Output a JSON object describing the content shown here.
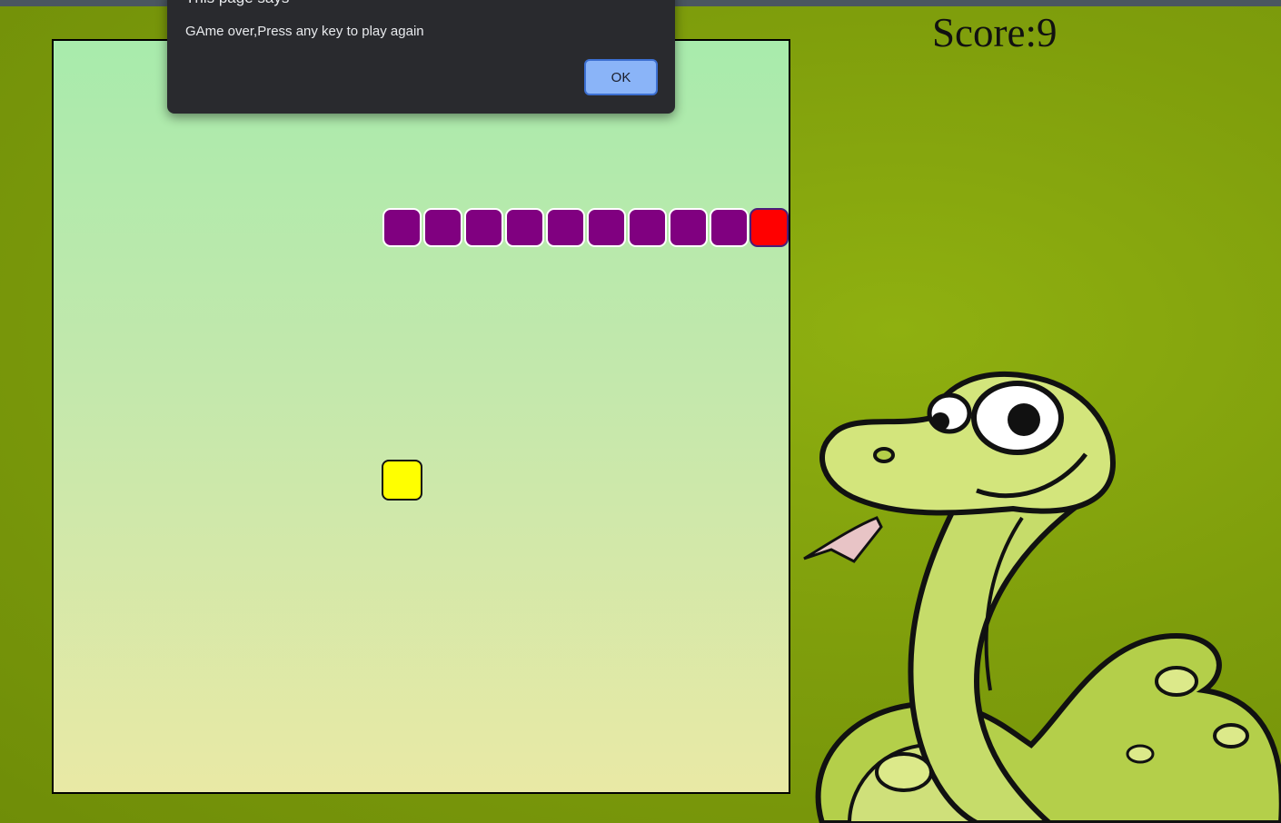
{
  "score": {
    "label": "Score:9"
  },
  "dialog": {
    "title": "This page says",
    "message": "GAme over,Press any key to play again",
    "ok_label": "OK"
  },
  "game": {
    "colors": {
      "head": "#ff0000",
      "body": "#800080",
      "food": "#ffff00"
    }
  }
}
